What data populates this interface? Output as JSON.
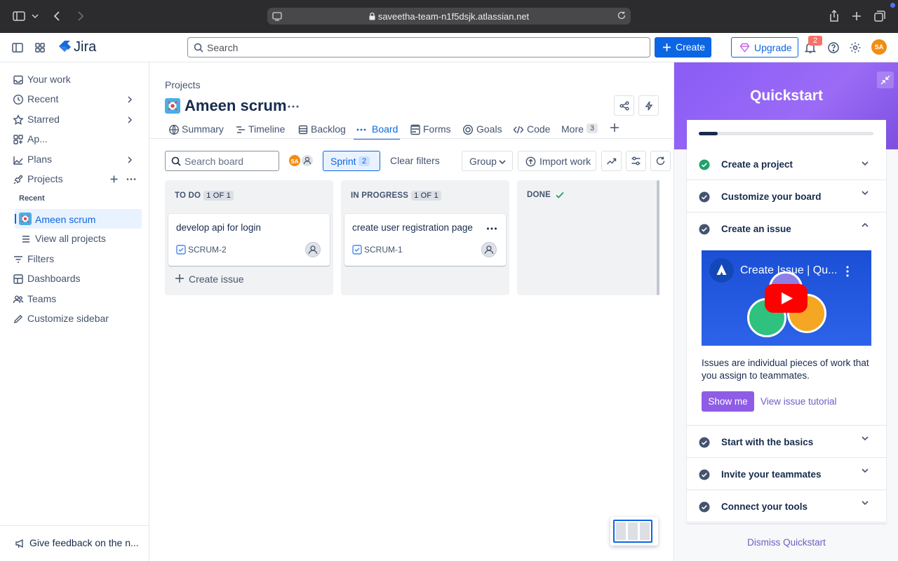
{
  "browser": {
    "url": "saveetha-team-n1f5dsjk.atlassian.net"
  },
  "topnav": {
    "app_name": "Jira",
    "search_placeholder": "Search",
    "create_label": "Create",
    "upgrade_label": "Upgrade",
    "notification_count": "2",
    "avatar_initials": "SA"
  },
  "sidebar": {
    "your_work": "Your work",
    "recent": "Recent",
    "starred": "Starred",
    "apps": "Ap...",
    "plans": "Plans",
    "projects": "Projects",
    "recent_section": "Recent",
    "project_name": "Ameen scrum",
    "view_all": "View all projects",
    "filters": "Filters",
    "dashboards": "Dashboards",
    "teams": "Teams",
    "customize": "Customize sidebar",
    "feedback": "Give feedback on the n..."
  },
  "main": {
    "breadcrumb": "Projects",
    "project_title": "Ameen scrum",
    "tabs": {
      "summary": "Summary",
      "timeline": "Timeline",
      "backlog": "Backlog",
      "board": "Board",
      "forms": "Forms",
      "goals": "Goals",
      "code": "Code",
      "more": "More",
      "more_count": "3"
    },
    "search_board_placeholder": "Search board",
    "sprint_label": "Sprint",
    "sprint_count": "2",
    "clear_filters": "Clear filters",
    "group_label": "Group",
    "import_label": "Import work",
    "columns": {
      "todo": {
        "title": "TO DO",
        "count": "1 OF 1"
      },
      "inprogress": {
        "title": "IN PROGRESS",
        "count": "1 OF 1"
      },
      "done": {
        "title": "DONE"
      }
    },
    "cards": {
      "todo": {
        "title": "develop api for login",
        "key": "SCRUM-2"
      },
      "inprogress": {
        "title": "create user registration page",
        "key": "SCRUM-1"
      }
    },
    "create_issue": "Create issue"
  },
  "quickstart": {
    "title": "Quickstart",
    "progress": 0.11,
    "items": {
      "create_project": "Create a project",
      "customize_board": "Customize your board",
      "create_issue": "Create an issue",
      "basics": "Start with the basics",
      "invite": "Invite your teammates",
      "tools": "Connect your tools"
    },
    "video_title": "Create Issue | Qu...",
    "description": "Issues are individual pieces of work that you assign to teammates.",
    "show_me": "Show me",
    "tutorial_link": "View issue tutorial",
    "dismiss": "Dismiss Quickstart"
  },
  "colors": {
    "accent": "#0c66e4",
    "quickstart_purple": "#8a5cf5",
    "success_green": "#22a06b",
    "avatar_orange": "#f18d13"
  }
}
